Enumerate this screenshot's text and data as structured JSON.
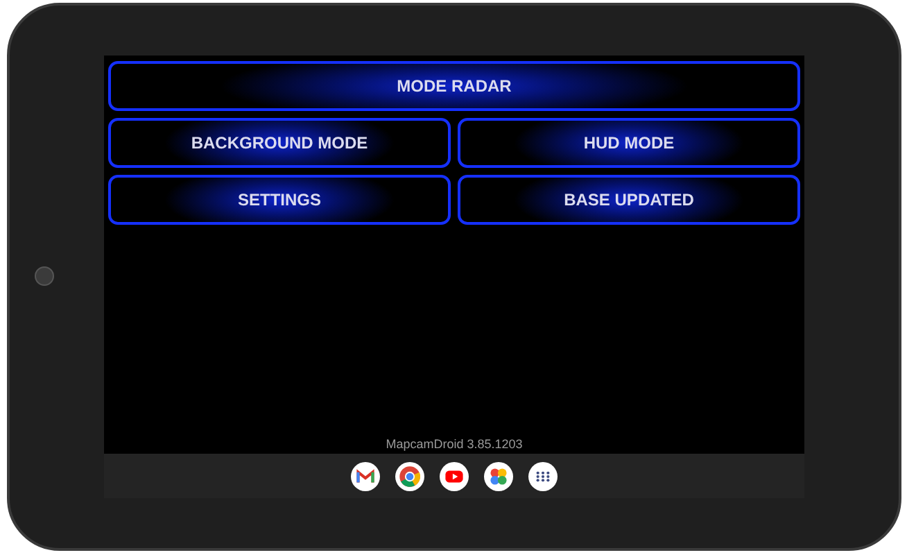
{
  "menu_buttons": [
    {
      "label": "MODE RADAR",
      "kind": "wide"
    },
    {
      "label": "BACKGROUND MODE",
      "kind": "half"
    },
    {
      "label": "HUD MODE",
      "kind": "half"
    },
    {
      "label": "SETTINGS",
      "kind": "half"
    },
    {
      "label": "BASE UPDATED",
      "kind": "half"
    }
  ],
  "version": "MapcamDroid 3.85.1203"
}
